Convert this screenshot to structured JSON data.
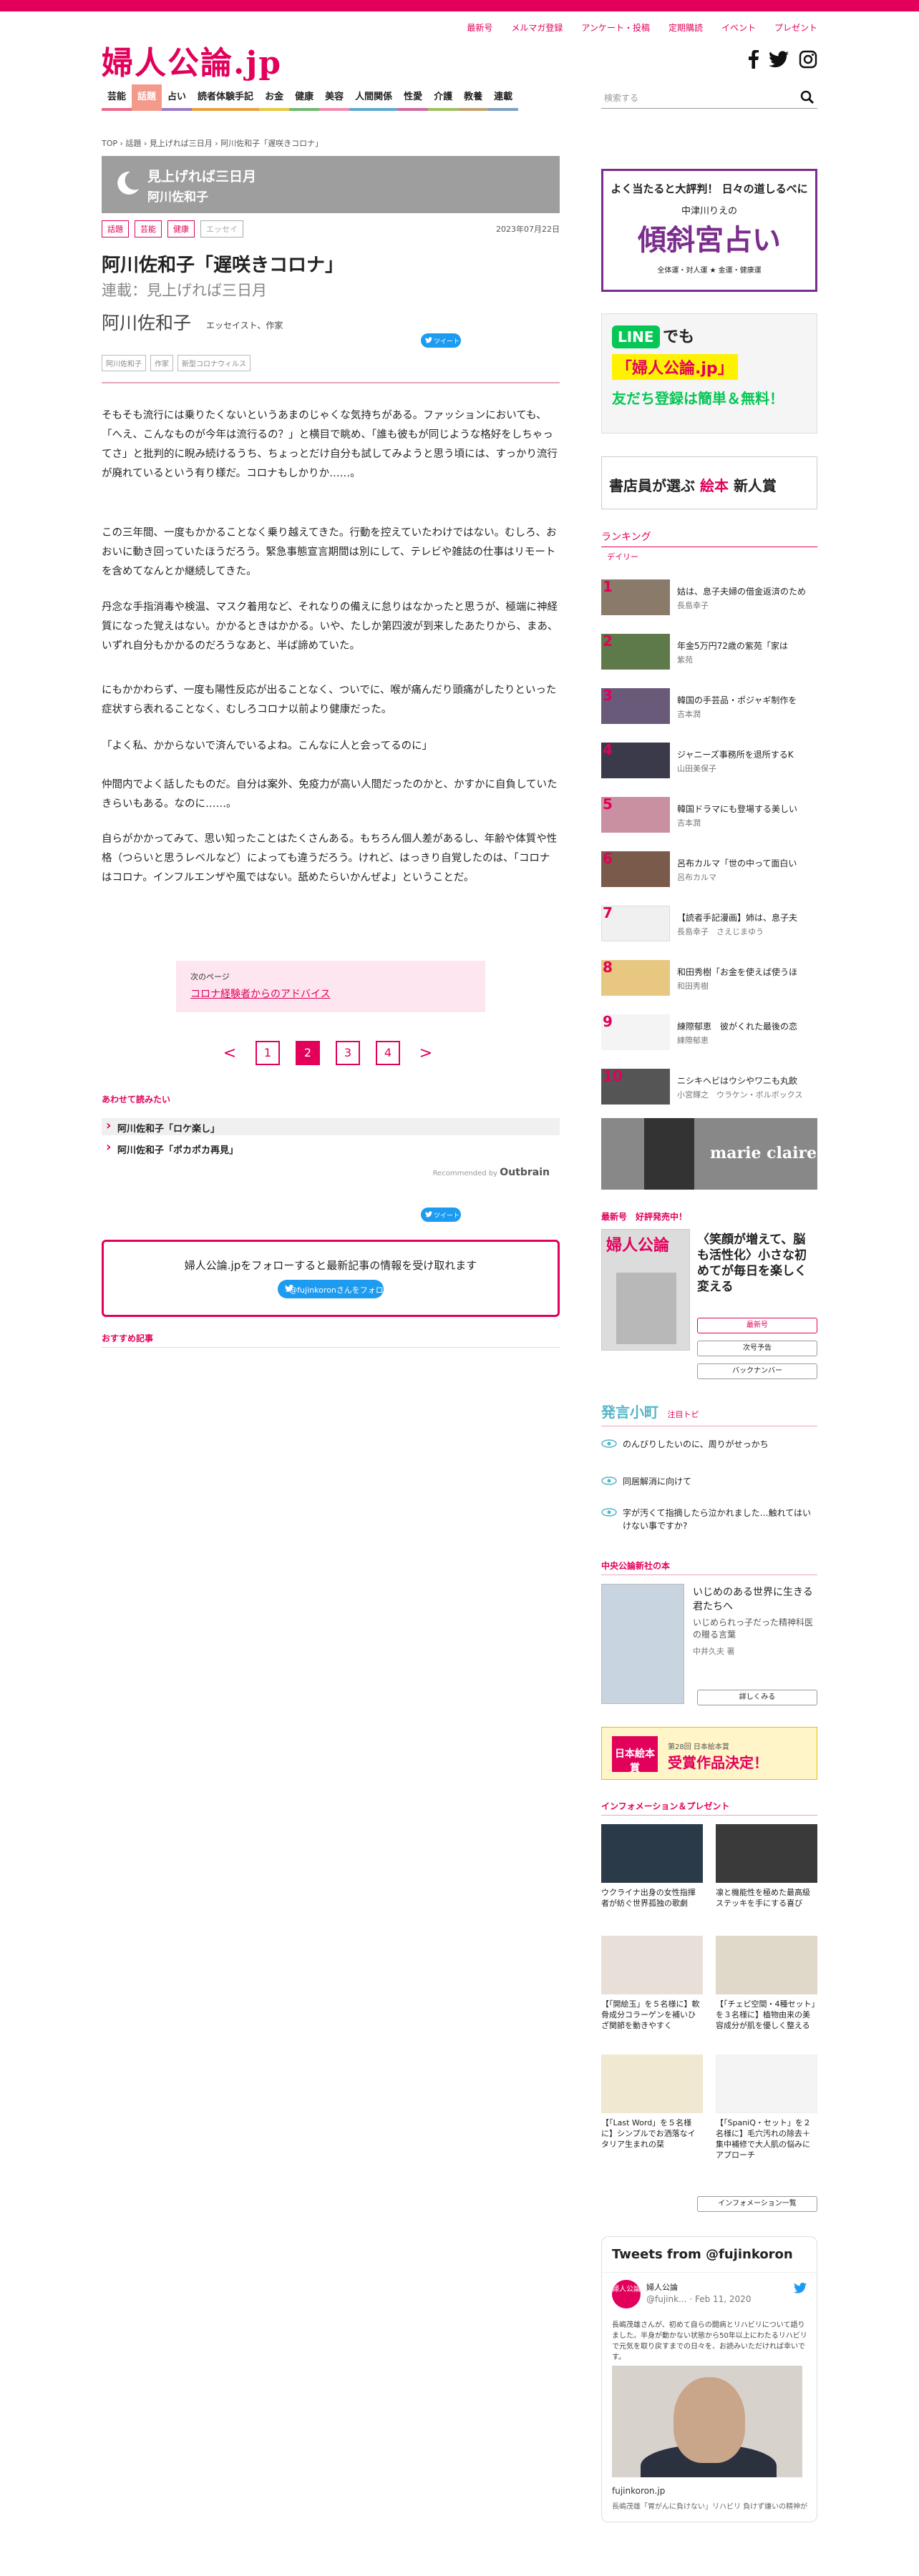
{
  "site": {
    "logo": "婦人公論.jp",
    "util_nav": [
      "最新号",
      "メルマガ登録",
      "アンケート・投稿",
      "定期購読",
      "イベント",
      "プレゼント"
    ],
    "global_nav": [
      "芸能",
      "話題",
      "占い",
      "読者体験手記",
      "お金",
      "健康",
      "美容",
      "人間関係",
      "性愛",
      "介護",
      "教養",
      "連載"
    ],
    "global_nav_active": "話題",
    "search_placeholder": "検索する",
    "accent_color": "#e2005a"
  },
  "breadcrumb": "TOP › 話題 › 見上げれば三日月 › 阿川佐和子「遅咲きコロナ」",
  "series_banner": {
    "line1": "見上げれば三日月",
    "line2": "阿川佐和子"
  },
  "article": {
    "tags": [
      "話題",
      "芸能",
      "健康",
      "エッセイ"
    ],
    "date": "2023年07月22日",
    "title": "阿川佐和子「遅咲きコロナ」",
    "subtitle": "連載：見上げれば三日月",
    "author": "阿川佐和子",
    "author_role": "エッセイスト、作家",
    "tweet_label": "ツイート",
    "keyword_tags": [
      "阿川佐和子",
      "作家",
      "新型コロナウィルス"
    ],
    "paragraphs": [
      "そもそも流行には乗りたくないというあまのじゃくな気持ちがある。ファッションにおいても、「へえ、こんなものが今年は流行るの？」と横目で眺め、「誰も彼もが同じような格好をしちゃってさ」と批判的に睨み続けるうち、ちょっとだけ自分も試してみようと思う頃には、すっかり流行が廃れているという有り様だ。コロナもしかりか……。",
      "この三年間、一度もかかることなく乗り越えてきた。行動を控えていたわけではない。むしろ、おおいに動き回っていたほうだろう。緊急事態宣言期間は別にして、テレビや雑誌の仕事はリモートを含めてなんとか継続してきた。",
      "丹念な手指消毒や検温、マスク着用など、それなりの備えに怠りはなかったと思うが、極端に神経質になった覚えはない。かかるときはかかる。いや、たしか第四波が到来したあたりから、まあ、いずれ自分もかかるのだろうなあと、半ば諦めていた。",
      "にもかかわらず、一度も陽性反応が出ることなく、ついでに、喉が痛んだり頭痛がしたりといった症状すら表れることなく、むしろコロナ以前より健康だった。",
      "「よく私、かからないで済んでいるよね。こんなに人と会ってるのに」",
      "仲間内でよく話したものだ。自分は案外、免疫力が高い人間だったのかと、かすかに自負していたきらいもある。なのに……。",
      "自らがかかってみて、思い知ったことはたくさんある。もちろん個人差があるし、年齢や体質や性格（つらいと思うレベルなど）によっても違うだろう。けれど、はっきり自覚したのは、「コロナはコロナ。インフルエンザや風ではない。舐めたらいかんぜよ」ということだ。"
    ]
  },
  "next_page": {
    "label": "次のページ",
    "link": "コロナ経験者からのアドバイス"
  },
  "pager": {
    "prev": "<",
    "next": ">",
    "pages": [
      "1",
      "2",
      "3",
      "4"
    ],
    "current": "2"
  },
  "related": {
    "title": "あわせて読みたい",
    "items": [
      "阿川佐和子「ロケ楽し」",
      "阿川佐和子「ポカポカ再見」"
    ],
    "recommended_by": "Recommended by",
    "outbrain": "Outbrain"
  },
  "follow": {
    "text": "婦人公論.jpをフォローすると最新記事の情報を受け取れます",
    "button": "@fujinkoronさんをフォロー"
  },
  "recommend_title": "おすすめ記事",
  "sidebar": {
    "ad_uranai": {
      "headline": "よく当たると大評判！ 日々の道しるべに",
      "author": "中津川りえの",
      "title": "傾斜宮占い",
      "foot": "全体運・対人運 ★ 金運・健康運"
    },
    "ad_line": {
      "logo": "LINE",
      "suffix": "でも",
      "name": "「婦人公論.jp」",
      "cta": "友だち登録は簡単＆無料！"
    },
    "ad_ehon": {
      "prefix": "書店員が選ぶ",
      "red": "絵本",
      "suffix": "新人賞"
    },
    "ranking": {
      "title": "ランキング",
      "tab": "デイリー",
      "items": [
        {
          "num": "1",
          "title": "姑は、息子夫婦の借金返済のため",
          "author": "長島幸子",
          "color": "#8a7a6a"
        },
        {
          "num": "2",
          "title": "年金5万円72歳の紫苑「家は",
          "author": "紫苑",
          "color": "#5e7a4a"
        },
        {
          "num": "3",
          "title": "韓国の手芸品・ポジャギ制作を",
          "author": "吉本潤",
          "color": "#6a5a7a"
        },
        {
          "num": "4",
          "title": "ジャニーズ事務所を退所するK",
          "author": "山田美保子",
          "color": "#3a3a4a"
        },
        {
          "num": "5",
          "title": "韓国ドラマにも登場する美しい",
          "author": "吉本潤",
          "color": "#c890a0"
        },
        {
          "num": "6",
          "title": "呂布カルマ「世の中って面白い",
          "author": "呂布カルマ",
          "color": "#7a5a4a"
        },
        {
          "num": "7",
          "title": "【読者手記漫画】姉は、息子夫",
          "author": "長島幸子　さえじまゆう",
          "color": "#ffffff"
        },
        {
          "num": "8",
          "title": "和田秀樹「お金を使えば使うほ",
          "author": "和田秀樹",
          "color": "#e8c880"
        },
        {
          "num": "9",
          "title": "練際郁恵　彼がくれた最後の恋",
          "author": "練際郁恵",
          "color": "#ffffff"
        },
        {
          "num": "10",
          "title": "ニシキヘビはウシやワニも丸飲",
          "author": "小宮輝之　ウラケン・ボルボックス",
          "color": "#555555"
        }
      ]
    },
    "ad_mc": "marie claire",
    "magazine": {
      "label": "最新号　好評発売中！",
      "cover_title": "婦人公論",
      "headline": "〈笑顔が増えて、脳も活性化〉小さな初めてが毎日を楽しく変える",
      "buttons": [
        "最新号",
        "次号予告",
        "バックナンバー"
      ]
    },
    "hatsugen": {
      "logo": "発言小町",
      "sub": "注目トピ",
      "items": [
        "のんびりしたいのに、周りがせっかち",
        "同居解消に向けて",
        "字が汚くて指摘したら泣かれました…触れてはいけない事ですか?"
      ]
    },
    "chuko": {
      "title": "中央公論新社の本",
      "book_title": "いじめのある世界に生きる君たちへ",
      "book_sub": "いじめられっ子だった精神科医の贈る言葉",
      "book_author": "中井久夫 著",
      "button": "詳しくみる"
    },
    "ad_award": {
      "logo": "日本絵本賞",
      "small": "第28回 日本絵本賞",
      "title": "受賞作品決定！"
    },
    "info": {
      "title": "インフォメーション＆プレゼント",
      "items": [
        {
          "cap": "ウクライナ出身の女性指揮者が紡ぐ世界孤独の歌劇",
          "color": "#2a3a48"
        },
        {
          "cap": "凛と機能性を極めた最高級ステッキを手にする喜び",
          "color": "#3a3a3a"
        },
        {
          "cap": "【「開絵玉」を５名様に】軟骨成分コラーゲンを補いひざ関節を動きやすく",
          "color": "#e8e0d8"
        },
        {
          "cap": "【「チェビ空間・4種セット」を３名様に】植物由来の美容成分が肌を優しく整える",
          "color": "#e0d8c8"
        },
        {
          "cap": "【「Last Word」を５名様に】シンプルでお洒落なイタリア生まれの栞",
          "color": "#f0e8d0"
        },
        {
          "cap": "【「SpaniQ・セット」を２名様に】毛穴汚れの除去＋集中補修で大人肌の悩みにアプローチ",
          "color": "#f4f4f4"
        }
      ],
      "button": "インフォメーション一覧"
    },
    "tweets": {
      "header": "Tweets from @fujinkoron",
      "avatar": "婦人公論",
      "name": "婦人公論",
      "handle": "@fujink...",
      "date": "· Feb 11, 2020",
      "text": "長嶋茂雄さんが、初めて自らの闘病とリハビリについて語りました。半身が動かない状態から50年以上にわたるリハビリで元気を取り戻すまでの日々を、お読みいただければ幸いです。",
      "domain": "fujinkoron.jp",
      "desc": "長嶋茂雄「胃がんに負けない」リハビリ 負けず嫌いの精神が生きる力に"
    }
  }
}
